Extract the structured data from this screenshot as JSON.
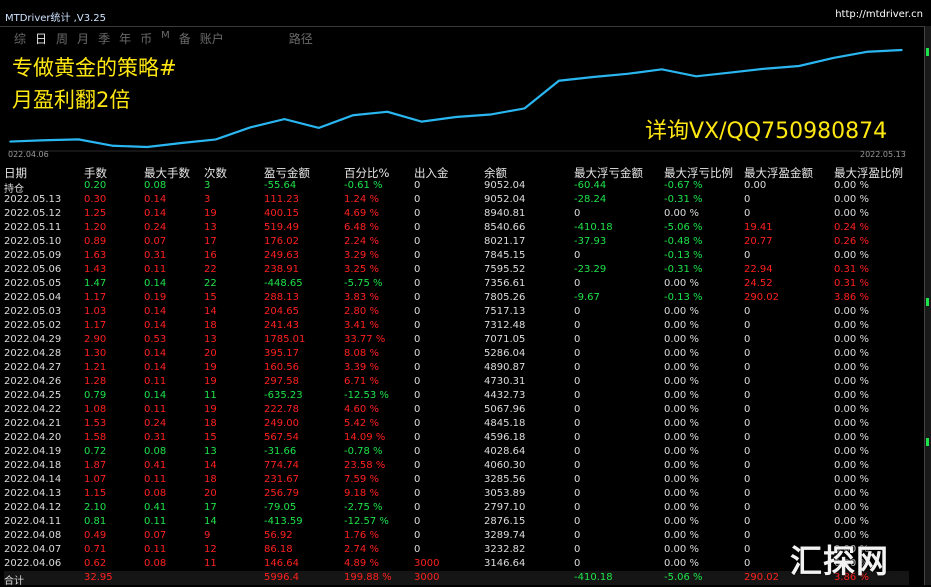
{
  "window": {
    "title": "MTDriver统计 ,V3.25",
    "url": "http://mtdriver.cn"
  },
  "tabs": [
    {
      "label": "综",
      "active": false
    },
    {
      "label": "日",
      "active": true
    },
    {
      "label": "周",
      "active": false
    },
    {
      "label": "月",
      "active": false
    },
    {
      "label": "季",
      "active": false
    },
    {
      "label": "年",
      "active": false
    },
    {
      "label": "币",
      "active": false
    },
    {
      "label": "M",
      "active": false
    },
    {
      "label": "备",
      "active": false
    },
    {
      "label": "账户",
      "active": false
    },
    {
      "label": "路径",
      "active": false
    }
  ],
  "promo": {
    "line1": "专做黄金的策略#",
    "line2": "月盈利翻2倍",
    "line3": "详询VX/QQ750980874"
  },
  "chart_data": {
    "type": "line",
    "x_start_label": "022.04.06",
    "x_end_label": "2022.05.13",
    "series": [
      {
        "values": [
          3146.64,
          3232.82,
          3289.74,
          2876.15,
          2797.1,
          3053.89,
          3285.56,
          4060.3,
          4596.18,
          4028.64,
          4845.18,
          5067.96,
          4432.73,
          4730.31,
          4890.87,
          5286.04,
          7071.05,
          7312.48,
          7517.13,
          7805.26,
          7356.61,
          7595.52,
          7845.15,
          8021.17,
          8540.66,
          8940.81,
          9052.04
        ]
      }
    ],
    "color": "#2ab6f0"
  },
  "table": {
    "headers": [
      "日期",
      "手数",
      "最大手数",
      "次数",
      "盈亏金额",
      "百分比%",
      "出入金",
      "余额",
      "最大浮亏金额",
      "最大浮亏比例",
      "最大浮盈金额",
      "最大浮盈比例"
    ],
    "rows": [
      {
        "c": "w",
        "v": [
          "持仓",
          "0.20",
          "0.08",
          "3",
          "-55.64",
          "-0.61 %",
          "0",
          "9052.04",
          "-60.44",
          "-0.67 %",
          "0.00",
          "0.00 %"
        ]
      },
      {
        "c": "r",
        "v": [
          "2022.05.13",
          "0.30",
          "0.14",
          "3",
          "111.23",
          "1.24 %",
          "0",
          "9052.04",
          "-28.24",
          "-0.31 %",
          "0",
          "0.00 %"
        ]
      },
      {
        "c": "r",
        "v": [
          "2022.05.12",
          "1.25",
          "0.14",
          "19",
          "400.15",
          "4.69 %",
          "0",
          "8940.81",
          "0",
          "0.00 %",
          "0",
          "0.00 %"
        ]
      },
      {
        "c": "r",
        "v": [
          "2022.05.11",
          "1.20",
          "0.24",
          "13",
          "519.49",
          "6.48 %",
          "0",
          "8540.66",
          "-410.18",
          "-5.06 %",
          "19.41",
          "0.24 %"
        ]
      },
      {
        "c": "r",
        "v": [
          "2022.05.10",
          "0.89",
          "0.07",
          "17",
          "176.02",
          "2.24 %",
          "0",
          "8021.17",
          "-37.93",
          "-0.48 %",
          "20.77",
          "0.26 %"
        ]
      },
      {
        "c": "r",
        "v": [
          "2022.05.09",
          "1.63",
          "0.31",
          "16",
          "249.63",
          "3.29 %",
          "0",
          "7845.15",
          "0",
          "-0.13 %",
          "0",
          "0.00 %"
        ]
      },
      {
        "c": "r",
        "v": [
          "2022.05.06",
          "1.43",
          "0.11",
          "22",
          "238.91",
          "3.25 %",
          "0",
          "7595.52",
          "-23.29",
          "-0.31 %",
          "22.94",
          "0.31 %"
        ]
      },
      {
        "c": "g",
        "v": [
          "2022.05.05",
          "1.47",
          "0.14",
          "22",
          "-448.65",
          "-5.75 %",
          "0",
          "7356.61",
          "0",
          "0.00 %",
          "24.52",
          "0.31 %"
        ]
      },
      {
        "c": "r",
        "v": [
          "2022.05.04",
          "1.17",
          "0.19",
          "15",
          "288.13",
          "3.83 %",
          "0",
          "7805.26",
          "-9.67",
          "-0.13 %",
          "290.02",
          "3.86 %"
        ]
      },
      {
        "c": "r",
        "v": [
          "2022.05.03",
          "1.03",
          "0.14",
          "14",
          "204.65",
          "2.80 %",
          "0",
          "7517.13",
          "0",
          "0.00 %",
          "0",
          "0.00 %"
        ]
      },
      {
        "c": "r",
        "v": [
          "2022.05.02",
          "1.17",
          "0.14",
          "18",
          "241.43",
          "3.41 %",
          "0",
          "7312.48",
          "0",
          "0.00 %",
          "0",
          "0.00 %"
        ]
      },
      {
        "c": "r",
        "v": [
          "2022.04.29",
          "2.90",
          "0.53",
          "13",
          "1785.01",
          "33.77 %",
          "0",
          "7071.05",
          "0",
          "0.00 %",
          "0",
          "0.00 %"
        ]
      },
      {
        "c": "r",
        "v": [
          "2022.04.28",
          "1.30",
          "0.14",
          "20",
          "395.17",
          "8.08 %",
          "0",
          "5286.04",
          "0",
          "0.00 %",
          "0",
          "0.00 %"
        ]
      },
      {
        "c": "r",
        "v": [
          "2022.04.27",
          "1.21",
          "0.14",
          "19",
          "160.56",
          "3.39 %",
          "0",
          "4890.87",
          "0",
          "0.00 %",
          "0",
          "0.00 %"
        ]
      },
      {
        "c": "r",
        "v": [
          "2022.04.26",
          "1.28",
          "0.11",
          "19",
          "297.58",
          "6.71 %",
          "0",
          "4730.31",
          "0",
          "0.00 %",
          "0",
          "0.00 %"
        ]
      },
      {
        "c": "g",
        "v": [
          "2022.04.25",
          "0.79",
          "0.14",
          "11",
          "-635.23",
          "-12.53 %",
          "0",
          "4432.73",
          "0",
          "0.00 %",
          "0",
          "0.00 %"
        ]
      },
      {
        "c": "r",
        "v": [
          "2022.04.22",
          "1.08",
          "0.11",
          "19",
          "222.78",
          "4.60 %",
          "0",
          "5067.96",
          "0",
          "0.00 %",
          "0",
          "0.00 %"
        ]
      },
      {
        "c": "r",
        "v": [
          "2022.04.21",
          "1.53",
          "0.24",
          "18",
          "249.00",
          "5.42 %",
          "0",
          "4845.18",
          "0",
          "0.00 %",
          "0",
          "0.00 %"
        ]
      },
      {
        "c": "r",
        "v": [
          "2022.04.20",
          "1.58",
          "0.31",
          "15",
          "567.54",
          "14.09 %",
          "0",
          "4596.18",
          "0",
          "0.00 %",
          "0",
          "0.00 %"
        ]
      },
      {
        "c": "g",
        "v": [
          "2022.04.19",
          "0.72",
          "0.08",
          "13",
          "-31.66",
          "-0.78 %",
          "0",
          "4028.64",
          "0",
          "0.00 %",
          "0",
          "0.00 %"
        ]
      },
      {
        "c": "r",
        "v": [
          "2022.04.18",
          "1.87",
          "0.41",
          "14",
          "774.74",
          "23.58 %",
          "0",
          "4060.30",
          "0",
          "0.00 %",
          "0",
          "0.00 %"
        ]
      },
      {
        "c": "r",
        "v": [
          "2022.04.14",
          "1.07",
          "0.11",
          "18",
          "231.67",
          "7.59 %",
          "0",
          "3285.56",
          "0",
          "0.00 %",
          "0",
          "0.00 %"
        ]
      },
      {
        "c": "r",
        "v": [
          "2022.04.13",
          "1.15",
          "0.08",
          "20",
          "256.79",
          "9.18 %",
          "0",
          "3053.89",
          "0",
          "0.00 %",
          "0",
          "0.00 %"
        ]
      },
      {
        "c": "g",
        "v": [
          "2022.04.12",
          "2.10",
          "0.41",
          "17",
          "-79.05",
          "-2.75 %",
          "0",
          "2797.10",
          "0",
          "0.00 %",
          "0",
          "0.00 %"
        ]
      },
      {
        "c": "g",
        "v": [
          "2022.04.11",
          "0.81",
          "0.11",
          "14",
          "-413.59",
          "-12.57 %",
          "0",
          "2876.15",
          "0",
          "0.00 %",
          "0",
          "0.00 %"
        ]
      },
      {
        "c": "r",
        "v": [
          "2022.04.08",
          "0.49",
          "0.07",
          "9",
          "56.92",
          "1.76 %",
          "0",
          "3289.74",
          "0",
          "0.00 %",
          "0",
          "0.00 %"
        ]
      },
      {
        "c": "r",
        "v": [
          "2022.04.07",
          "0.71",
          "0.11",
          "12",
          "86.18",
          "2.74 %",
          "0",
          "3232.82",
          "0",
          "0.00 %",
          "0",
          "0.00 %"
        ]
      },
      {
        "c": "r",
        "v": [
          "2022.04.06",
          "0.62",
          "0.08",
          "11",
          "146.64",
          "4.89 %",
          "3000",
          "3146.64",
          "0",
          "0.00 %",
          "0",
          "0.00 %"
        ]
      },
      {
        "c": "r",
        "v": [
          "合计",
          "32.95",
          "",
          "",
          "5996.4",
          "199.88 %",
          "3000",
          "",
          "-410.18",
          "-5.06 %",
          "290.02",
          "3.86 %"
        ]
      }
    ]
  },
  "watermark": "汇探网",
  "colors": {
    "profit": "#ff2020",
    "loss": "#1ee34a",
    "line": "#2ab6f0",
    "promo": "#ffe812"
  }
}
